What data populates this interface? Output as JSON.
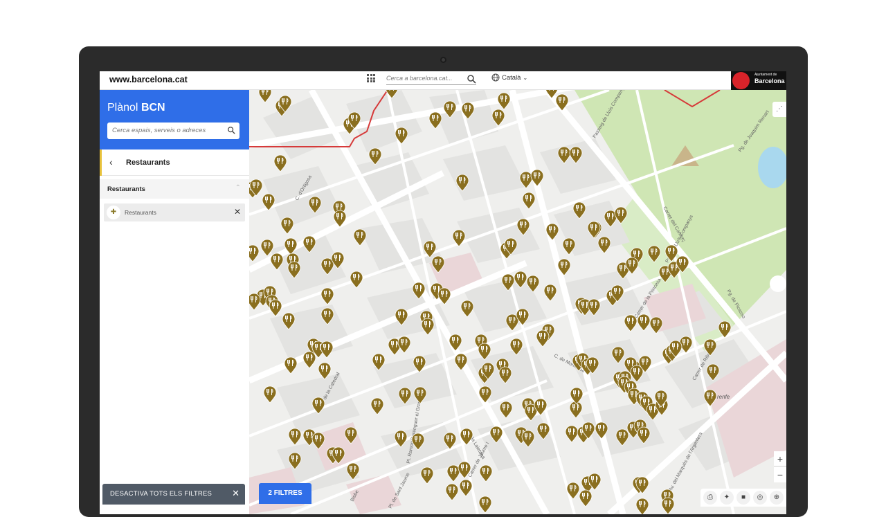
{
  "topbar": {
    "site": "www.barcelona.cat",
    "search_placeholder": "Cerca a barcelona.cat...",
    "language": "Català",
    "brand_small": "Ajuntament de",
    "brand_big": "Barcelona"
  },
  "panel": {
    "title_light": "Plànol",
    "title_bold": "BCN",
    "search_placeholder": "Cerca espais, serveis o adreces",
    "back_label": "Restaurants",
    "section_label": "Restaurants",
    "filter_label": "Restaurants",
    "disable_label": "DESACTIVA TOTS ELS FILTRES"
  },
  "map": {
    "filters_button": "2 FILTRES",
    "street_labels": {
      "s1": "Av. de la Catedral",
      "s2": "Via Laietana",
      "s3": "Av. del Marquès de l'Argentera",
      "s4": "Pg. de Picasso",
      "s5": "Carrer de la Princesa",
      "s6": "C. de Montcada",
      "s7": "Pl. Ramon Berenguer el Gran",
      "s8": "Passeig de Lluís Companys",
      "s9": "Carrer del Comerç",
      "s10": "Carrer de Jaume I",
      "s11": "Pg. de Joaquim Renart",
      "s12": "Carrer de Ribera",
      "s13": "Pl. de Sant Jaume",
      "s14": "C. d'Ortigosa",
      "s15": "Passeig Lluís Companys",
      "s16": "Bisbe"
    },
    "station_label": "renfe",
    "pin_category": "restaurant-pin",
    "colors": {
      "pin": "#8a6f1f",
      "park": "#cfe6b4",
      "accent": "#2f6ee8",
      "boundary": "#d63a3a"
    }
  }
}
